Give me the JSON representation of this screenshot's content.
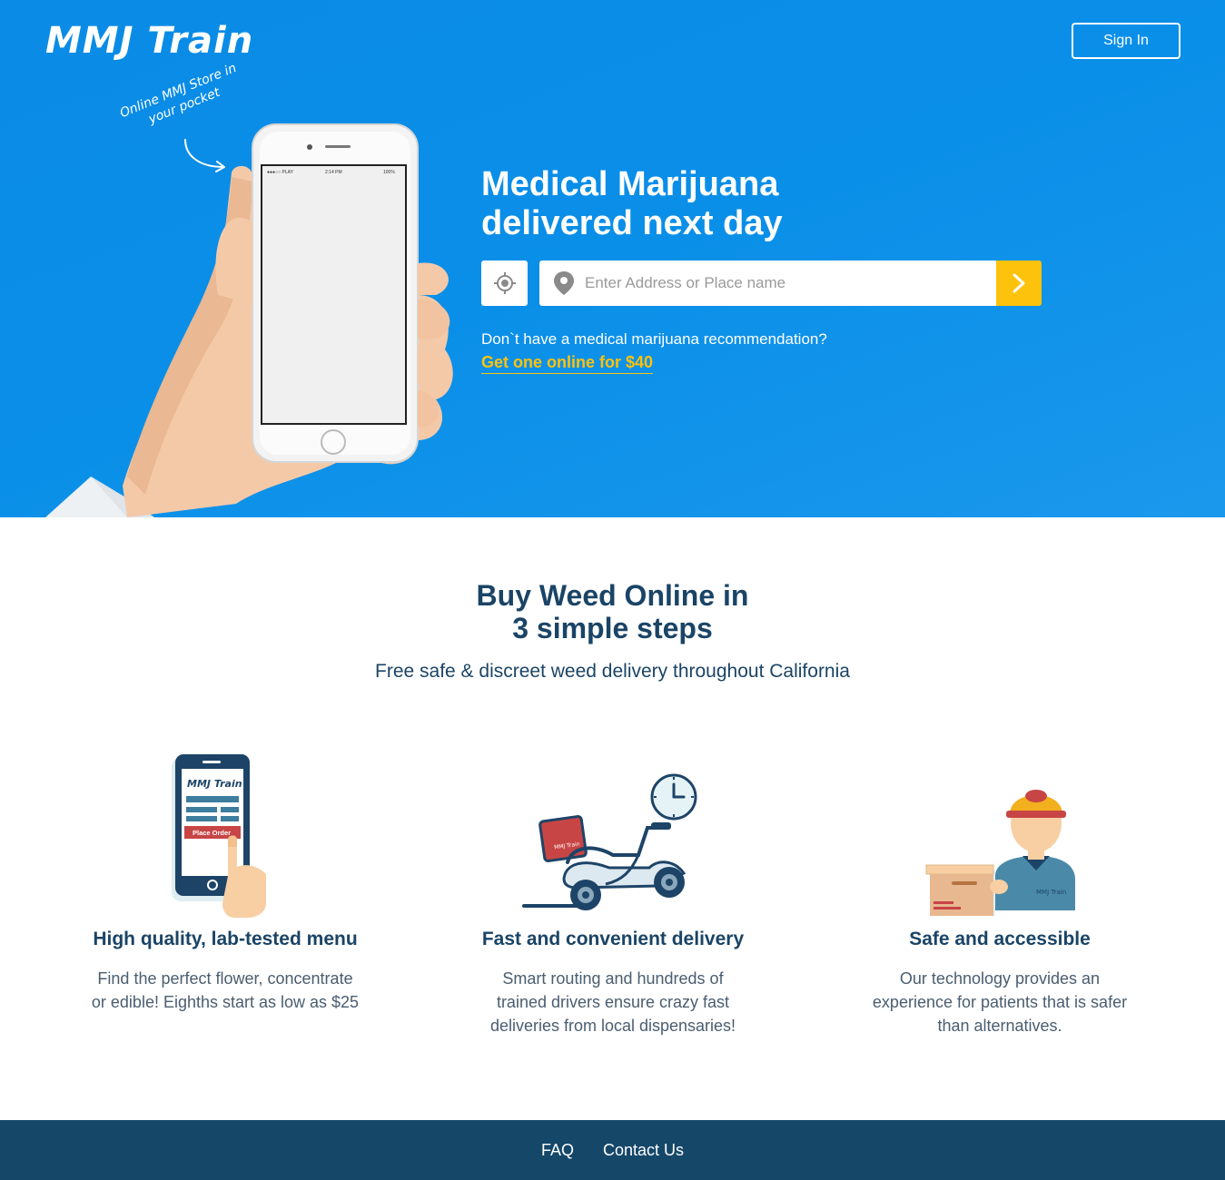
{
  "header": {
    "logo": "MMJ Train",
    "signin_label": "Sign In"
  },
  "hero": {
    "tagline": "Online MMJ Store in your pocket",
    "headline_line1": "Medical Marijuana",
    "headline_line2": "delivered next day",
    "address_placeholder": "Enter Address or Place name",
    "recommendation_question": "Don`t have a medical marijuana recommendation?",
    "recommendation_link": "Get one online for $40",
    "phone_status_left": "●●●○○ PLAY",
    "phone_status_time": "2:14 PM",
    "phone_status_battery": "100%"
  },
  "steps": {
    "title_line1": "Buy Weed Online in",
    "title_line2": "3 simple steps",
    "subtitle": "Free safe & discreet weed delivery throughout California",
    "items": [
      {
        "title": "High quality, lab-tested menu",
        "text": "Find the perfect flower, concentrate or edible! Eighths start as low as $25",
        "icon": "phone-order-icon",
        "icon_brand": "MMJ Train",
        "icon_button": "Place Order"
      },
      {
        "title": "Fast and convenient delivery",
        "text": "Smart routing and hundreds of trained drivers ensure crazy fast deliveries from local dispensaries!",
        "icon": "scooter-delivery-icon",
        "icon_brand": "MMJ Train"
      },
      {
        "title": "Safe and accessible",
        "text": "Our technology provides an experience for patients that is safer than alternatives.",
        "icon": "delivery-man-icon",
        "icon_brand": "MMJ Train"
      }
    ]
  },
  "footer": {
    "links": [
      "FAQ",
      "Contact Us"
    ]
  },
  "colors": {
    "hero_blue": "#0a8be6",
    "accent_yellow": "#fdc20c",
    "navy": "#154769",
    "text_dark": "#1a4466"
  }
}
